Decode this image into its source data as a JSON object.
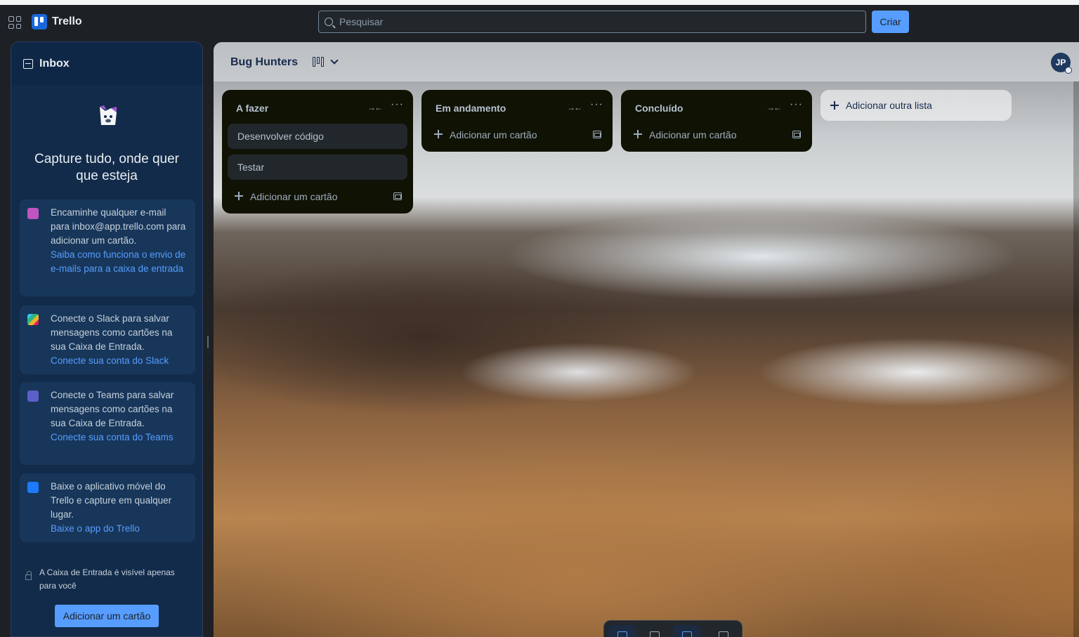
{
  "topbar": {
    "app_name": "Trello",
    "search_placeholder": "Pesquisar",
    "create_label": "Criar"
  },
  "inbox": {
    "title": "Inbox",
    "hero": "Capture tudo, onde quer que esteja",
    "tips": [
      {
        "icon": "email-icon",
        "text": "Encaminhe qualquer e-mail para inbox@app.trello.com para adicionar um cartão.",
        "link": "Saiba como funciona o envio de e-mails para a caixa de entrada"
      },
      {
        "icon": "slack-icon",
        "text": "Conecte o Slack para salvar mensagens como cartões na sua Caixa de Entrada.",
        "link": "Conecte sua conta do Slack"
      },
      {
        "icon": "teams-icon",
        "text": "Conecte o Teams para salvar mensagens como cartões na sua Caixa de Entrada.",
        "link": "Conecte sua conta do Teams"
      },
      {
        "icon": "mobile-icon",
        "text": "Baixe o aplicativo móvel do Trello e capture em qualquer lugar.",
        "link": "Baixe o app do Trello"
      }
    ],
    "footnote": "A Caixa de Entrada é visível apenas para você",
    "add_card_label": "Adicionar um cartão"
  },
  "board": {
    "name": "Bug Hunters",
    "avatar_initials": "JP",
    "lists": [
      {
        "title": "A fazer",
        "cards": [
          "Desenvolver código",
          "Testar"
        ],
        "add_label": "Adicionar um cartão"
      },
      {
        "title": "Em andamento",
        "cards": [],
        "add_label": "Adicionar um cartão"
      },
      {
        "title": "Concluído",
        "cards": [],
        "add_label": "Adicionar um cartão"
      }
    ],
    "add_list_label": "Adicionar outra lista"
  },
  "colors": {
    "accent": "#579dff",
    "list_bg": "#101204",
    "inbox_bg": "#122b4a"
  }
}
